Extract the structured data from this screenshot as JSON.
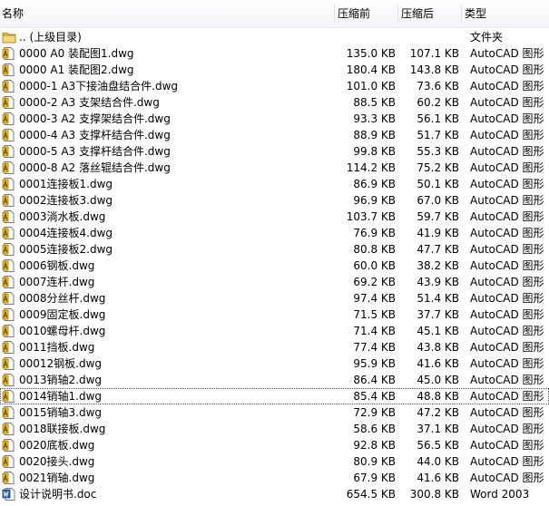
{
  "columns": {
    "name": "名称",
    "compressed": "压缩前",
    "size": "压缩后",
    "type": "类型"
  },
  "rows": [
    {
      "icon": "folder-up-icon",
      "name": ".. (上级目录)",
      "csize": "",
      "size": "",
      "type": "文件夹"
    },
    {
      "icon": "autocad-file-icon",
      "name": "0000 A0 装配图1.dwg",
      "csize": "135.0 KB",
      "size": "107.1 KB",
      "type": "AutoCAD 图形"
    },
    {
      "icon": "autocad-file-icon",
      "name": "0000 A1 装配图2.dwg",
      "csize": "180.4 KB",
      "size": "143.8 KB",
      "type": "AutoCAD 图形"
    },
    {
      "icon": "autocad-file-icon",
      "name": "0000-1 A3下接油盘结合件.dwg",
      "csize": "101.0 KB",
      "size": "73.6 KB",
      "type": "AutoCAD 图形"
    },
    {
      "icon": "autocad-file-icon",
      "name": "0000-2 A3  支架结合件.dwg",
      "csize": "88.5 KB",
      "size": "60.2 KB",
      "type": "AutoCAD 图形"
    },
    {
      "icon": "autocad-file-icon",
      "name": "0000-3 A2 支撑架结合件.dwg",
      "csize": "93.3 KB",
      "size": "56.1 KB",
      "type": "AutoCAD 图形"
    },
    {
      "icon": "autocad-file-icon",
      "name": "0000-4 A3 支撑杆结合件.dwg",
      "csize": "88.9 KB",
      "size": "51.7 KB",
      "type": "AutoCAD 图形"
    },
    {
      "icon": "autocad-file-icon",
      "name": "0000-5 A3 支撑杆结合件.dwg",
      "csize": "99.8 KB",
      "size": "55.3 KB",
      "type": "AutoCAD 图形"
    },
    {
      "icon": "autocad-file-icon",
      "name": "0000-8 A2 落丝辊结合件.dwg",
      "csize": "114.2 KB",
      "size": "75.2 KB",
      "type": "AutoCAD 图形"
    },
    {
      "icon": "autocad-file-icon",
      "name": "0001连接板1.dwg",
      "csize": "86.9 KB",
      "size": "50.1 KB",
      "type": "AutoCAD 图形"
    },
    {
      "icon": "autocad-file-icon",
      "name": "0002连接板3.dwg",
      "csize": "96.9 KB",
      "size": "67.0 KB",
      "type": "AutoCAD 图形"
    },
    {
      "icon": "autocad-file-icon",
      "name": "0003淌水板.dwg",
      "csize": "103.7 KB",
      "size": "59.7 KB",
      "type": "AutoCAD 图形"
    },
    {
      "icon": "autocad-file-icon",
      "name": "0004连接板4.dwg",
      "csize": "76.9 KB",
      "size": "41.9 KB",
      "type": "AutoCAD 图形"
    },
    {
      "icon": "autocad-file-icon",
      "name": "0005连接板2.dwg",
      "csize": "80.8 KB",
      "size": "47.7 KB",
      "type": "AutoCAD 图形"
    },
    {
      "icon": "autocad-file-icon",
      "name": "0006钢板.dwg",
      "csize": "60.0 KB",
      "size": "38.2 KB",
      "type": "AutoCAD 图形"
    },
    {
      "icon": "autocad-file-icon",
      "name": "0007连杆.dwg",
      "csize": "69.2 KB",
      "size": "43.9 KB",
      "type": "AutoCAD 图形"
    },
    {
      "icon": "autocad-file-icon",
      "name": "0008分丝杆.dwg",
      "csize": "97.4 KB",
      "size": "51.4 KB",
      "type": "AutoCAD 图形"
    },
    {
      "icon": "autocad-file-icon",
      "name": "0009固定板.dwg",
      "csize": "71.5 KB",
      "size": "37.7 KB",
      "type": "AutoCAD 图形"
    },
    {
      "icon": "autocad-file-icon",
      "name": "0010螺母杆.dwg",
      "csize": "71.4 KB",
      "size": "45.1 KB",
      "type": "AutoCAD 图形"
    },
    {
      "icon": "autocad-file-icon",
      "name": "0011挡板.dwg",
      "csize": "77.4 KB",
      "size": "43.8 KB",
      "type": "AutoCAD 图形"
    },
    {
      "icon": "autocad-file-icon",
      "name": "00012钢板.dwg",
      "csize": "95.9 KB",
      "size": "41.6 KB",
      "type": "AutoCAD 图形"
    },
    {
      "icon": "autocad-file-icon",
      "name": "0013销轴2.dwg",
      "csize": "86.4 KB",
      "size": "45.0 KB",
      "type": "AutoCAD 图形"
    },
    {
      "icon": "autocad-file-icon",
      "name": "0014销轴1.dwg",
      "csize": "85.4 KB",
      "size": "48.8 KB",
      "type": "AutoCAD 图形",
      "selected": true
    },
    {
      "icon": "autocad-file-icon",
      "name": "0015销轴3.dwg",
      "csize": "72.9 KB",
      "size": "47.2 KB",
      "type": "AutoCAD 图形"
    },
    {
      "icon": "autocad-file-icon",
      "name": "0018联接板.dwg",
      "csize": "58.6 KB",
      "size": "37.1 KB",
      "type": "AutoCAD 图形"
    },
    {
      "icon": "autocad-file-icon",
      "name": "0020底板.dwg",
      "csize": "92.8 KB",
      "size": "56.5 KB",
      "type": "AutoCAD 图形"
    },
    {
      "icon": "autocad-file-icon",
      "name": "0020接头.dwg",
      "csize": "80.9 KB",
      "size": "44.0 KB",
      "type": "AutoCAD 图形"
    },
    {
      "icon": "autocad-file-icon",
      "name": "0021销轴.dwg",
      "csize": "67.9 KB",
      "size": "41.6 KB",
      "type": "AutoCAD 图形"
    },
    {
      "icon": "word-doc-icon",
      "name": "设计说明书.doc",
      "csize": "654.5 KB",
      "size": "300.8 KB",
      "type": "Word 2003"
    }
  ]
}
